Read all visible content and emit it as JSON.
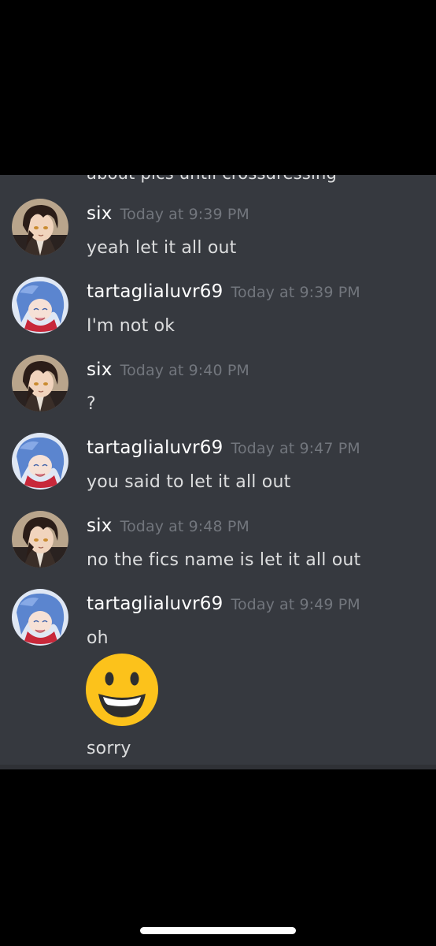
{
  "chat": {
    "cutoff_text": "about pics until crossdressing",
    "messages": [
      {
        "username": "six",
        "timestamp": "Today at 9:39 PM",
        "lines": [
          "yeah let it all out"
        ],
        "avatar": "dark-hair-character-avatar"
      },
      {
        "username": "tartaglialuvr69",
        "timestamp": "Today at 9:39 PM",
        "lines": [
          "I'm not ok"
        ],
        "avatar": "blue-hair-character-avatar"
      },
      {
        "username": "six",
        "timestamp": "Today at 9:40 PM",
        "lines": [
          "?"
        ],
        "avatar": "dark-hair-character-avatar"
      },
      {
        "username": "tartaglialuvr69",
        "timestamp": "Today at 9:47 PM",
        "lines": [
          "you said to let it all out"
        ],
        "avatar": "blue-hair-character-avatar"
      },
      {
        "username": "six",
        "timestamp": "Today at 9:48 PM",
        "lines": [
          "no the fics name is let it all out"
        ],
        "avatar": "dark-hair-character-avatar"
      },
      {
        "username": "tartaglialuvr69",
        "timestamp": "Today at 9:49 PM",
        "lines": [
          "oh",
          "sorry"
        ],
        "avatar": "blue-hair-character-avatar",
        "emoji": "grinning-face-emoji"
      }
    ]
  },
  "colors": {
    "background": "#36393f",
    "username": "#ffffff",
    "timestamp": "#72767d",
    "message_text": "#dcddde",
    "emoji_yellow": "#fcc21b"
  }
}
